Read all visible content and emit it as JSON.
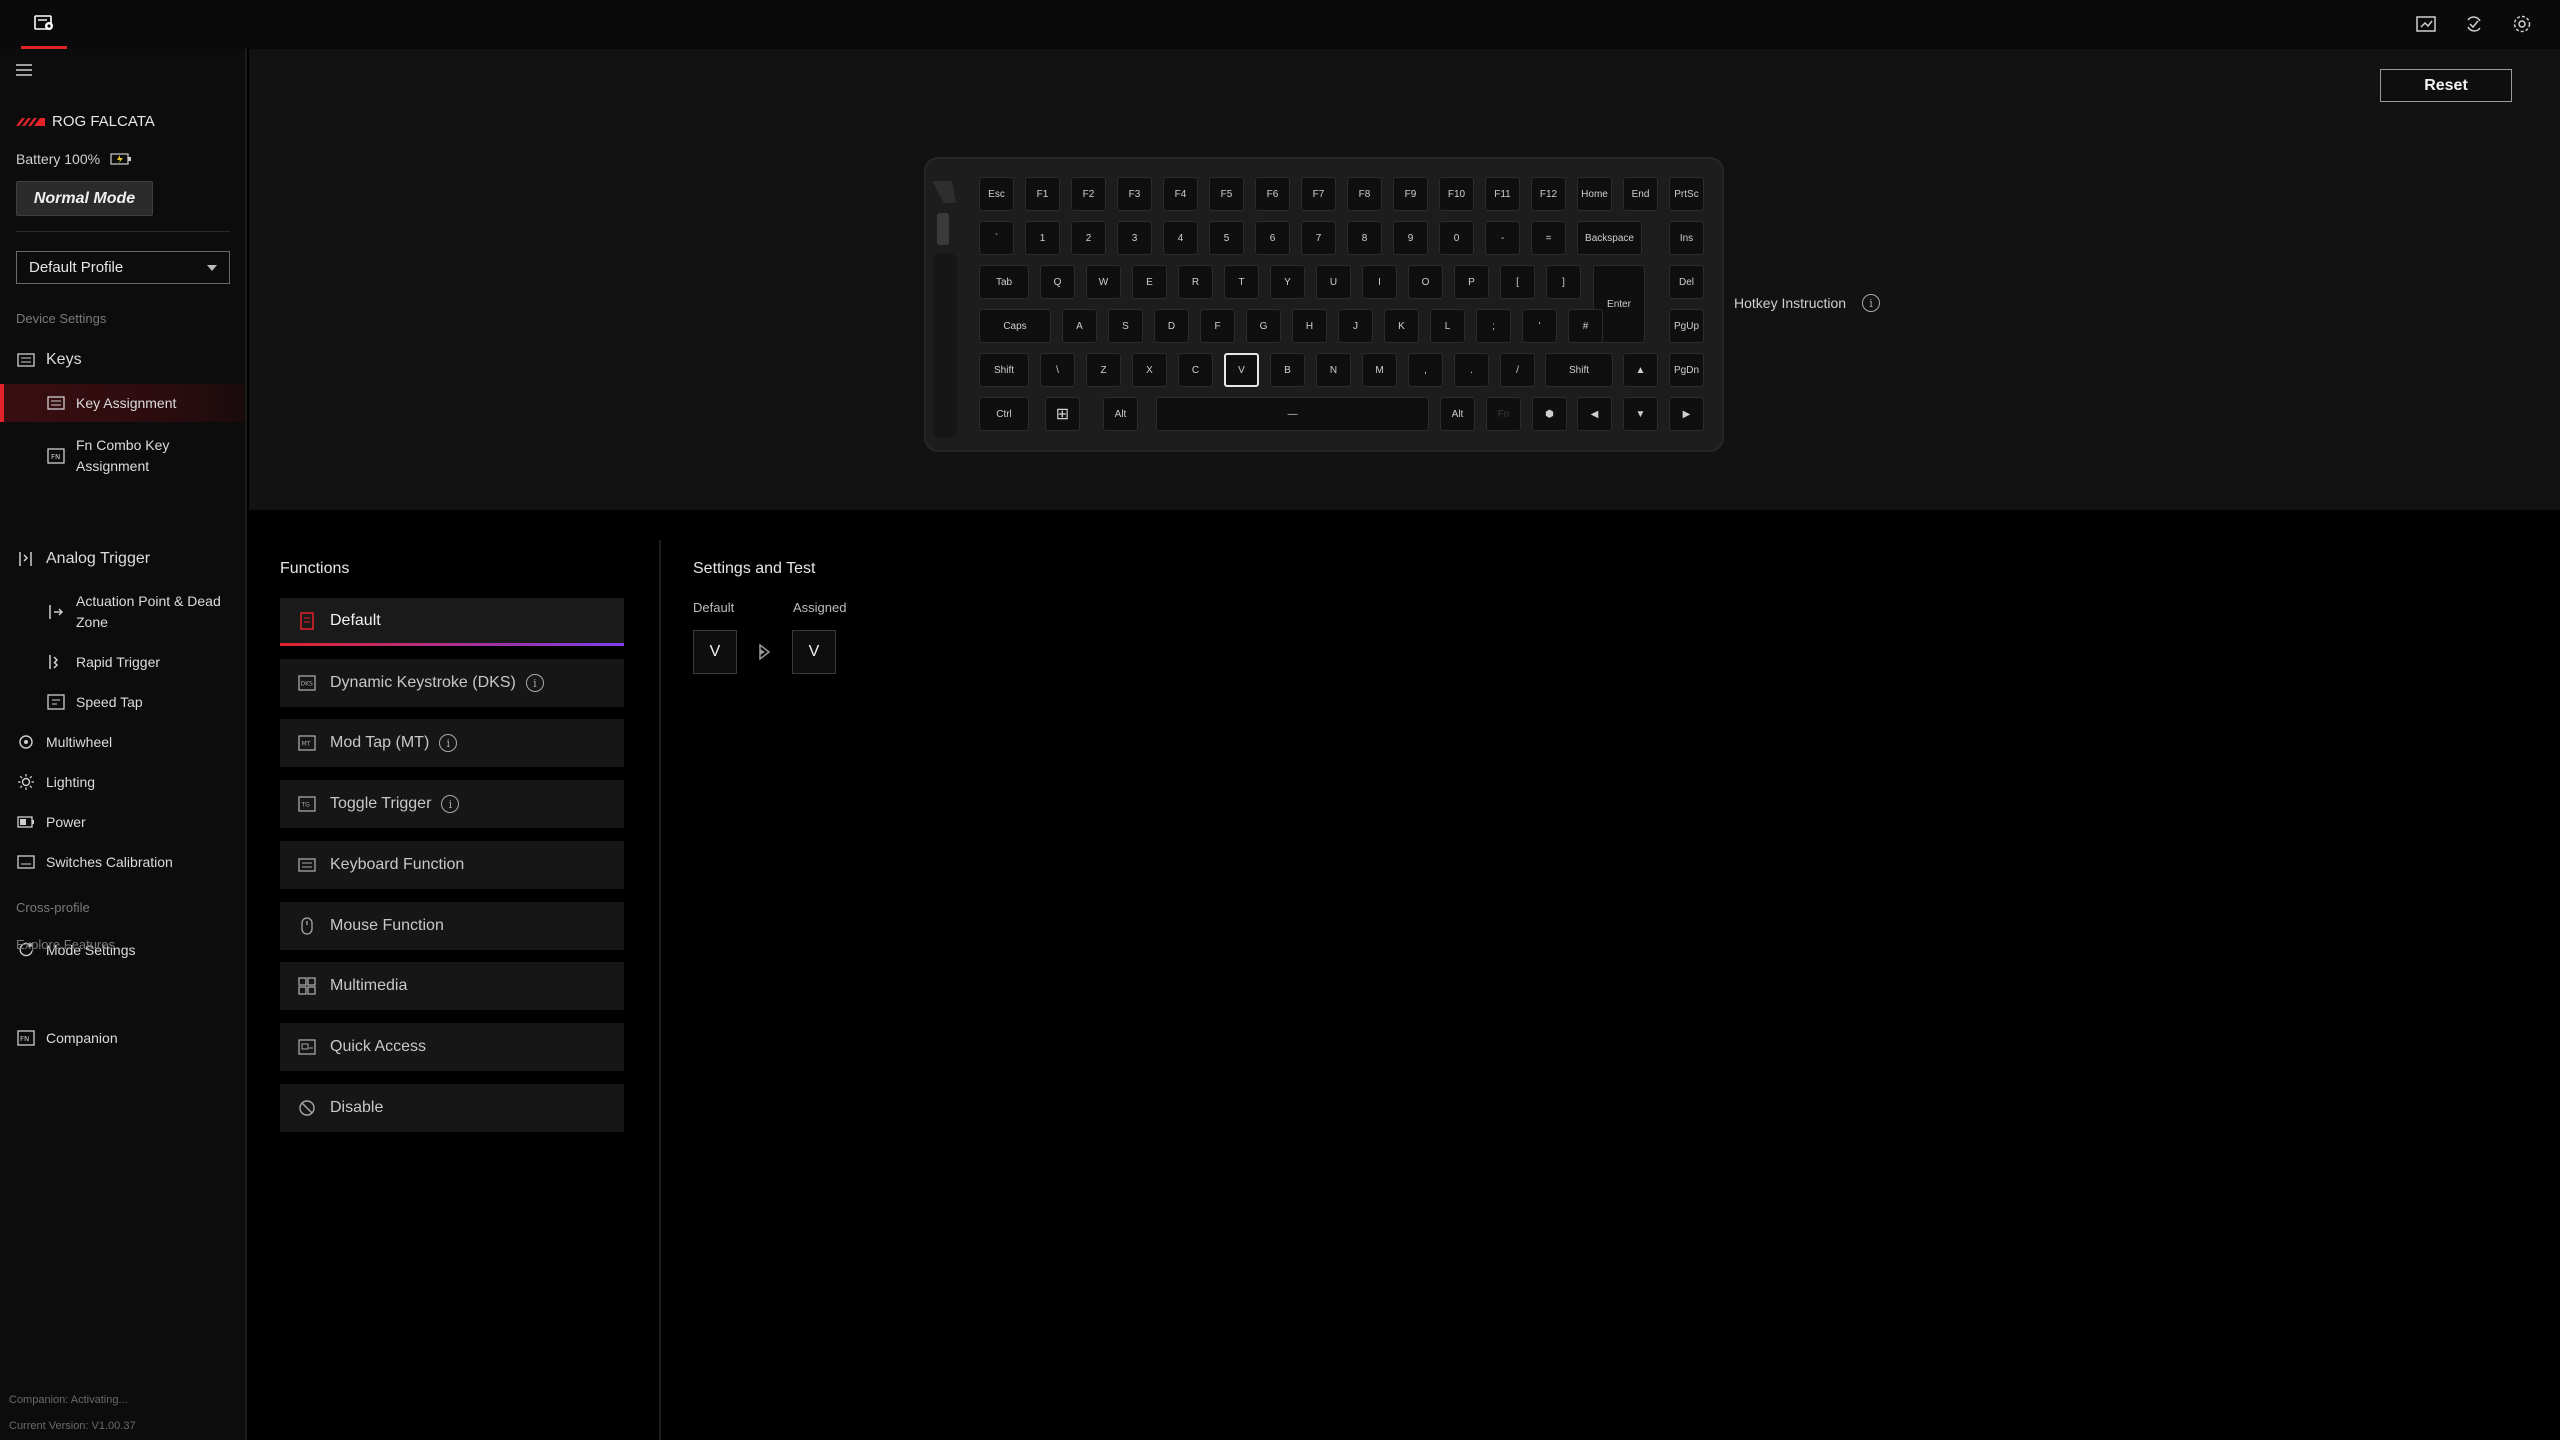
{
  "sidebar": {
    "device_name": "ROG FALCATA",
    "battery": "Battery 100%",
    "mode": "Normal Mode",
    "profile": "Default Profile",
    "sections": {
      "device_settings": "Device Settings",
      "cross_profile": "Cross-profile",
      "explore": "Explore Features"
    },
    "items": {
      "keys": "Keys",
      "key_assignment": "Key Assignment",
      "fn_combo_1": "Fn Combo Key",
      "fn_combo_2": "Assignment",
      "analog_trigger": "Analog Trigger",
      "actuation_1": "Actuation Point & Dead",
      "actuation_2": "Zone",
      "rapid_trigger": "Rapid Trigger",
      "speed_tap": "Speed Tap",
      "multiwheel": "Multiwheel",
      "lighting": "Lighting",
      "power": "Power",
      "switches_calibration": "Switches Calibration",
      "mode_settings": "Mode Settings",
      "companion": "Companion"
    },
    "footer": {
      "companion_status": "Companion: Activating...",
      "version": "Current Version: V1.00.37"
    }
  },
  "header": {
    "reset_label": "Reset"
  },
  "keyboard": {
    "hotkey_instruction": "Hotkey Instruction",
    "selected_key": "V",
    "rows": [
      [
        "Esc",
        "F1",
        "F2",
        "F3",
        "F4",
        "F5",
        "F6",
        "F7",
        "F8",
        "F9",
        "F10",
        "F11",
        "F12",
        "Home",
        "End",
        "PrtSc"
      ],
      [
        "`",
        "1",
        "2",
        "3",
        "4",
        "5",
        "6",
        "7",
        "8",
        "9",
        "0",
        "-",
        "=",
        "Backspace",
        "Ins"
      ],
      [
        "Tab",
        "Q",
        "W",
        "E",
        "R",
        "T",
        "Y",
        "U",
        "I",
        "O",
        "P",
        "[",
        "]",
        "Enter",
        "Del"
      ],
      [
        "Caps",
        "A",
        "S",
        "D",
        "F",
        "G",
        "H",
        "J",
        "K",
        "L",
        ";",
        "'",
        "#",
        "PgUp"
      ],
      [
        "Shift",
        "\\",
        "Z",
        "X",
        "C",
        "V",
        "B",
        "N",
        "M",
        ",",
        ".",
        "/",
        "Shift",
        "▲",
        "PgDn"
      ],
      [
        "Ctrl",
        "⊞",
        "Alt",
        "—",
        "Alt",
        "Fn",
        "⬢",
        "◀",
        "▼",
        "▶"
      ]
    ]
  },
  "functions": {
    "title": "Functions",
    "items": [
      {
        "label": "Default",
        "icon": "default-icon",
        "info": false
      },
      {
        "label": "Dynamic Keystroke (DKS)",
        "icon": "dks-icon",
        "info": true
      },
      {
        "label": "Mod Tap (MT)",
        "icon": "mt-icon",
        "info": true
      },
      {
        "label": "Toggle Trigger",
        "icon": "toggle-icon",
        "info": true
      },
      {
        "label": "Keyboard Function",
        "icon": "keyboard-icon",
        "info": false
      },
      {
        "label": "Mouse Function",
        "icon": "mouse-icon",
        "info": false
      },
      {
        "label": "Multimedia",
        "icon": "multimedia-icon",
        "info": false
      },
      {
        "label": "Quick Access",
        "icon": "quick-access-icon",
        "info": false
      },
      {
        "label": "Disable",
        "icon": "disable-icon",
        "info": false
      }
    ]
  },
  "settings": {
    "title": "Settings and Test",
    "default_label": "Default",
    "assigned_label": "Assigned",
    "default_key": "V",
    "assigned_key": "V"
  },
  "colors": {
    "accent": "#e3232a",
    "accent_secondary": "#7b3df0",
    "background": "#000000",
    "panel": "#121212"
  }
}
